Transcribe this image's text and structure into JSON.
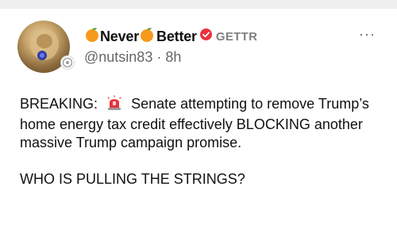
{
  "post": {
    "display_name_part1": "Never",
    "display_name_part2": "Better",
    "platform_label": "GETTR",
    "handle": "@nutsin83",
    "separator": "·",
    "timestamp": "8h",
    "more_label": "···",
    "body_prefix": "BREAKING:",
    "body_main": "Senate attempting to remove Trump’s home energy tax credit effectively BLOCKING another massive Trump campaign promise.",
    "body_question": "WHO IS PULLING THE STRINGS?"
  },
  "icons": {
    "name_emoji": "orange-emoji-icon",
    "verified": "red-check-badge-icon",
    "body_emoji": "siren-icon"
  },
  "colors": {
    "verified_red": "#e8323c",
    "orange": "#f59a1b",
    "muted_text": "#666666"
  }
}
